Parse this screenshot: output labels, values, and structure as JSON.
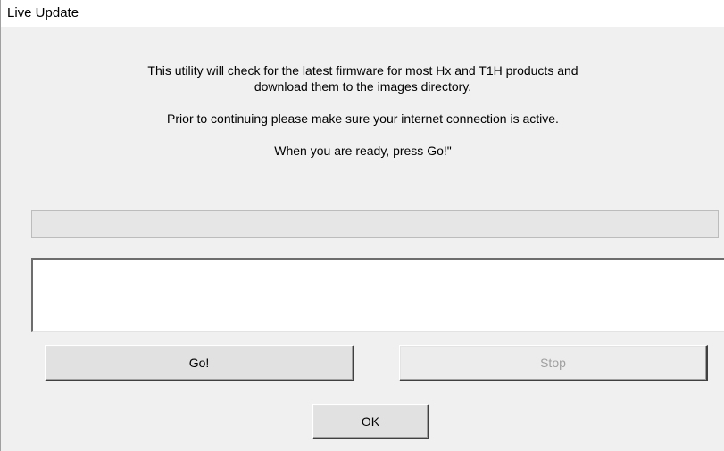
{
  "window": {
    "title": "Live Update"
  },
  "messages": {
    "intro_line1": "This utility will check for the latest firmware for most Hx and T1H products and",
    "intro_line2": "download them to the images directory.",
    "connection_note": "Prior to continuing please make sure your internet connection is active.",
    "ready_prompt": "When you are ready, press Go!\""
  },
  "progress": {
    "value": 0
  },
  "log": {
    "text": ""
  },
  "buttons": {
    "go_label": "Go!",
    "stop_label": "Stop",
    "ok_label": "OK"
  }
}
